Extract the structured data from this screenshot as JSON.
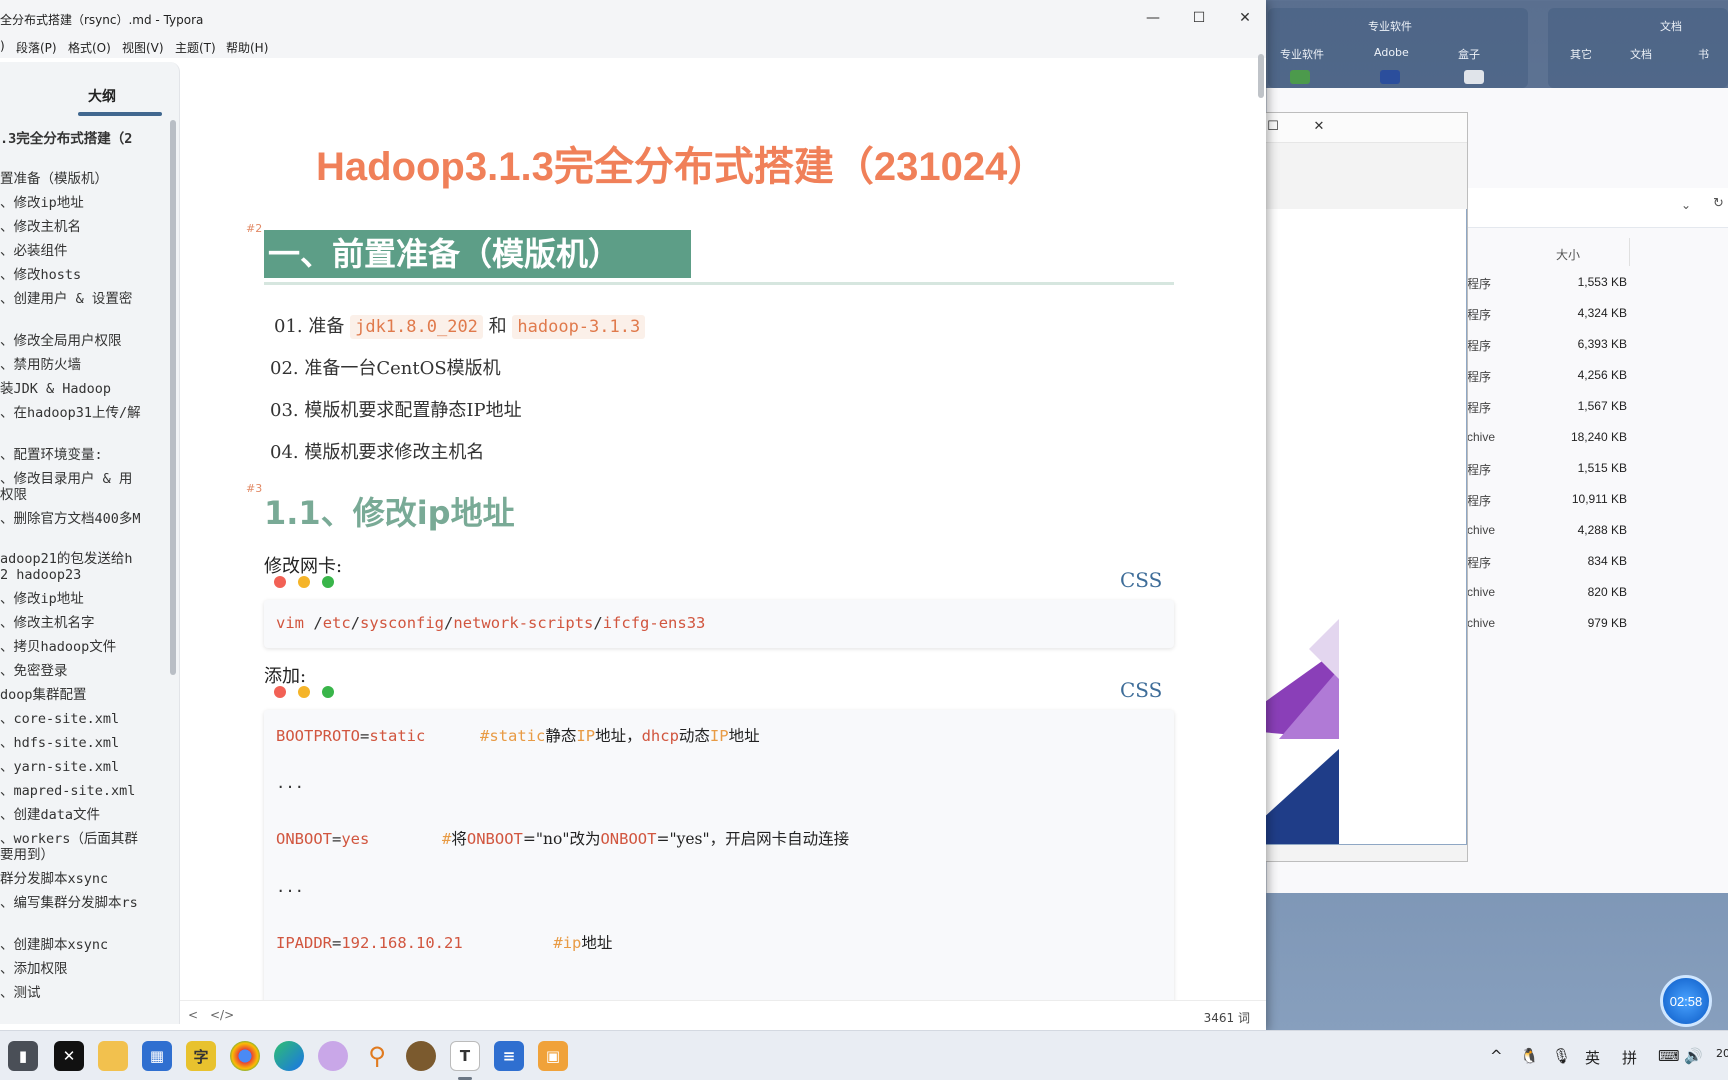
{
  "window": {
    "title": "全分布式搭建（rsync）.md - Typora",
    "minimize_glyph": "—",
    "maximize_glyph": "☐",
    "close_glyph": "✕"
  },
  "menu": [
    "段落(P)",
    "格式(O)",
    "视图(V)",
    "主题(T)",
    "帮助(H)"
  ],
  "menu_lead": ")",
  "sidebar": {
    "tab": "大纲",
    "items": [
      ".3完全分布式搭建（2",
      "置准备（模版机）",
      "、修改ip地址",
      "、修改主机名",
      "、必装组件",
      "、修改hosts",
      "、创建用户 & 设置密",
      "、修改全局用户权限",
      "、禁用防火墙",
      "装JDK & Hadoop",
      "、在hadoop31上传/解",
      "、配置环境变量:",
      "、修改目录用户 & 用",
      "权限",
      "、删除官方文档400多M",
      "adoop21的包发送给h",
      "2 hadoop23",
      "、修改ip地址",
      "、修改主机名字",
      "、拷贝hadoop文件",
      "、免密登录",
      "doop集群配置",
      "、core-site.xml",
      "、hdfs-site.xml",
      "、yarn-site.xml",
      "、mapred-site.xml",
      "、创建data文件",
      "、workers（后面其群",
      "要用到）",
      "群分发脚本xsync",
      "、编写集群分发脚本rs",
      "、创建脚本xsync",
      "、添加权限",
      "、测试"
    ]
  },
  "editor": {
    "title": "Hadoop3.1.3完全分布式搭建（231024）",
    "h2_mark": "#2",
    "h2": "一、前置准备（模版机）",
    "p1_prefix": "01. 准备",
    "p1_code1": "jdk1.8.0_202",
    "p1_and": "和",
    "p1_code2": "hadoop-3.1.3",
    "p2": "02. 准备一台CentOS模版机",
    "p3": "03. 模版机要求配置静态IP地址",
    "p4": "04. 模版机要求修改主机名",
    "h3_mark": "#3",
    "h3": "1.1、修改ip地址",
    "label1": "修改网卡:",
    "lang1": "CSS",
    "code1": {
      "t1": "vim",
      "t2": "/",
      "t3": "etc",
      "t4": "/",
      "t5": "sysconfig",
      "t6": "/",
      "t7": "network-scripts",
      "t8": "/",
      "t9": "ifcfg-ens33"
    },
    "label2": "添加:",
    "lang2": "CSS",
    "code2": {
      "l1_key": "BOOTPROTO",
      "l1_eq": "=",
      "l1_val": "static",
      "l1_hash": "#",
      "l1_cm": "static",
      "l1_t1": "静态",
      "l1_ip1": "IP",
      "l1_t2": "地址，",
      "l1_dhcp": "dhcp",
      "l1_t3": "动态",
      "l1_ip2": "IP",
      "l1_t4": "地址",
      "l2": "...",
      "l3_key": "ONBOOT",
      "l3_eq": "=",
      "l3_val": "yes",
      "l3_hash": "#",
      "l3_t1": "将",
      "l3_k1": "ONBOOT",
      "l3_eq2": "=\"no\"改为",
      "l3_k2": "ONBOOT",
      "l3_eq3": "=\"yes\"，开启网卡自动连接",
      "l4": "...",
      "l5_key": "IPADDR",
      "l5_eq": "=",
      "l5_val": "192.168.10.21",
      "l5_hash": "#",
      "l5_cm": "ip",
      "l5_t1": "地址"
    }
  },
  "status": {
    "back": "<",
    "source": "</>",
    "word_count": "3461 词"
  },
  "desktop": {
    "group1_title": "专业软件",
    "group1_items": [
      "专业软件",
      "Adobe",
      "盒子"
    ],
    "group2_title": "文档",
    "group2_items": [
      "其它",
      "文档",
      "书"
    ]
  },
  "explorer": {
    "size_header": "大小",
    "rows": [
      {
        "type": "程序",
        "size": "1,553 KB"
      },
      {
        "type": "程序",
        "size": "4,324 KB"
      },
      {
        "type": "程序",
        "size": "6,393 KB"
      },
      {
        "type": "程序",
        "size": "4,256 KB"
      },
      {
        "type": "程序",
        "size": "1,567 KB"
      },
      {
        "type": "chive",
        "size": "18,240 KB"
      },
      {
        "type": "程序",
        "size": "1,515 KB"
      },
      {
        "type": "程序",
        "size": "10,911 KB"
      },
      {
        "type": "chive",
        "size": "4,288 KB"
      },
      {
        "type": "程序",
        "size": "834 KB"
      },
      {
        "type": "chive",
        "size": "820 KB"
      },
      {
        "type": "chive",
        "size": "979 KB"
      }
    ]
  },
  "clock_bubble": "02:58",
  "taskbar": {
    "apps": [
      "task-view",
      "capcut",
      "file-explorer",
      "store",
      "dictionary",
      "chrome",
      "edge",
      "baidu-netdisk",
      "search-tool",
      "game",
      "typora",
      "notepad",
      "remote-desktop"
    ],
    "tray": [
      "^",
      "英",
      "拼",
      "20"
    ]
  },
  "colors": {
    "title_orange": "#f08059",
    "h2_green": "#5d9e87",
    "h3_green": "#79aa96",
    "code_red": "#d1563f",
    "code_comment": "#e89b45",
    "lang_blue": "#3e6d99"
  }
}
